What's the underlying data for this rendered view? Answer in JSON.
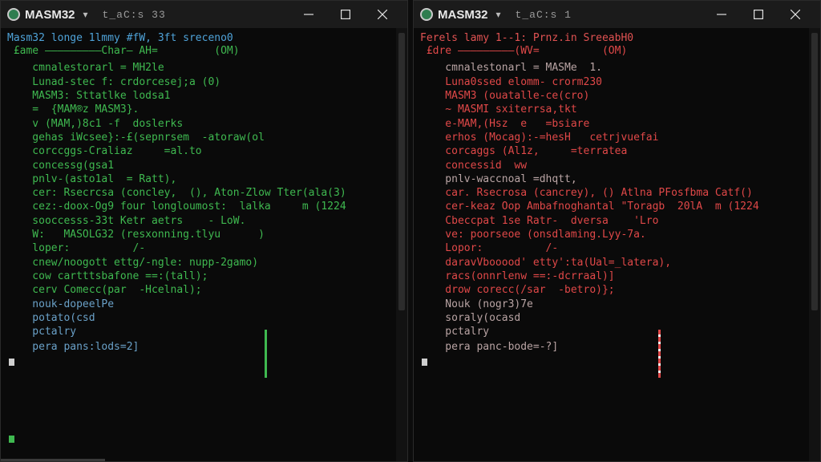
{
  "windows": [
    {
      "title": "MASM32",
      "tab_info": "t_aC:s  33",
      "lines": [
        "Masm32 longe 1lmmy #fW, 3ft sreceno0",
        " £ame —————————Char— AH=         (OM)",
        "    cmnalestorarl = MH2le",
        "    Lunad-stec f: crdorcesej;a (0)",
        "    MASM3: Sttatlke lodsa1",
        "    =  {MAM®z MASM3}.",
        "    v (MAM,)8c1 -f  doslerks",
        "    gehas iWcsee}:-£(sepnrsem  -atoraw(ol",
        "    corccggs-Craliaz     =al.to",
        "    concessg(gsa1",
        "    pnlv-(asto1al  = Ratt),",
        "    cer: Rsecrcsa (concley,  (), Aton-Zlow Tter(ala(3)",
        "    cez:-doox-Og9 four longloumost:  lalka     m (1224",
        "    sooccesss-33t Ketr aetrs    - LoW.",
        "    W:   MASOLG32 (resxonning.tlyu      )",
        "    loper:          /-",
        "    cnew/noogott ettg/-ngle: nupp-2gamo)",
        "    cow cartttsbafone ==:(tall);",
        "    cerv Comecc(par  -Hcelnal);",
        "    nouk-dopeelPe",
        "    potato(csd",
        "    pctalry",
        "    pera pans:lods=2]"
      ],
      "footer_prompt": "▪"
    },
    {
      "title": "MASM32",
      "tab_info": "t_aC:s  1",
      "lines": [
        "Ferels lamy 1--1: Prnz.in SreeabH0",
        " £dre —————————(WV=          (OM)",
        "    cmnalestonarl = MASMe  1.",
        "    Luna0ssed elomm- crorm230",
        "    MASM3 (ouatalle-ce(cro)",
        "    ~ MASMI sxiterrsa,tkt",
        "    e-MAM,(Hsz  e   =bsiare",
        "    erhos (Mocag):-=hesH   cetrjvuefai",
        "    corcaggs (Al1z,     =terratea",
        "    concessid  ww",
        "    pnlv-waccnoal =dhqtt,",
        "    car. Rsecrosa (cancrey), () Atlna PFosfbma Catf()",
        "    cer-keaz Oop Ambafnoghantal \"Toragb  20lA  m (1224",
        "    Cbeccpat 1se Ratr-  dversa    'Lro",
        "    ve: poorseoe (onsdlaming.Lyy-7a.",
        "    Lopor:          /-",
        "    daravVbooood' etty':ta(Ual=_latera),",
        "    racs(onnrlenw ==:-dcrraal)]",
        "    drow corecc(/sar  -betro)};",
        "    Nouk (nogr3)7e",
        "    soraly(ocasd",
        "    pctalry",
        "    pera panc-bode=-?]"
      ],
      "footer_prompt": "▪"
    }
  ],
  "colors": {
    "left_text": "#3fb950",
    "left_heading": "#4fa3d9",
    "right_text": "#e04848",
    "titlebar": "#1b1b1b",
    "background": "#0a0a0a"
  },
  "icons": [
    "app-icon",
    "chevron-down-icon",
    "minimize-icon",
    "maximize-icon",
    "close-icon"
  ]
}
